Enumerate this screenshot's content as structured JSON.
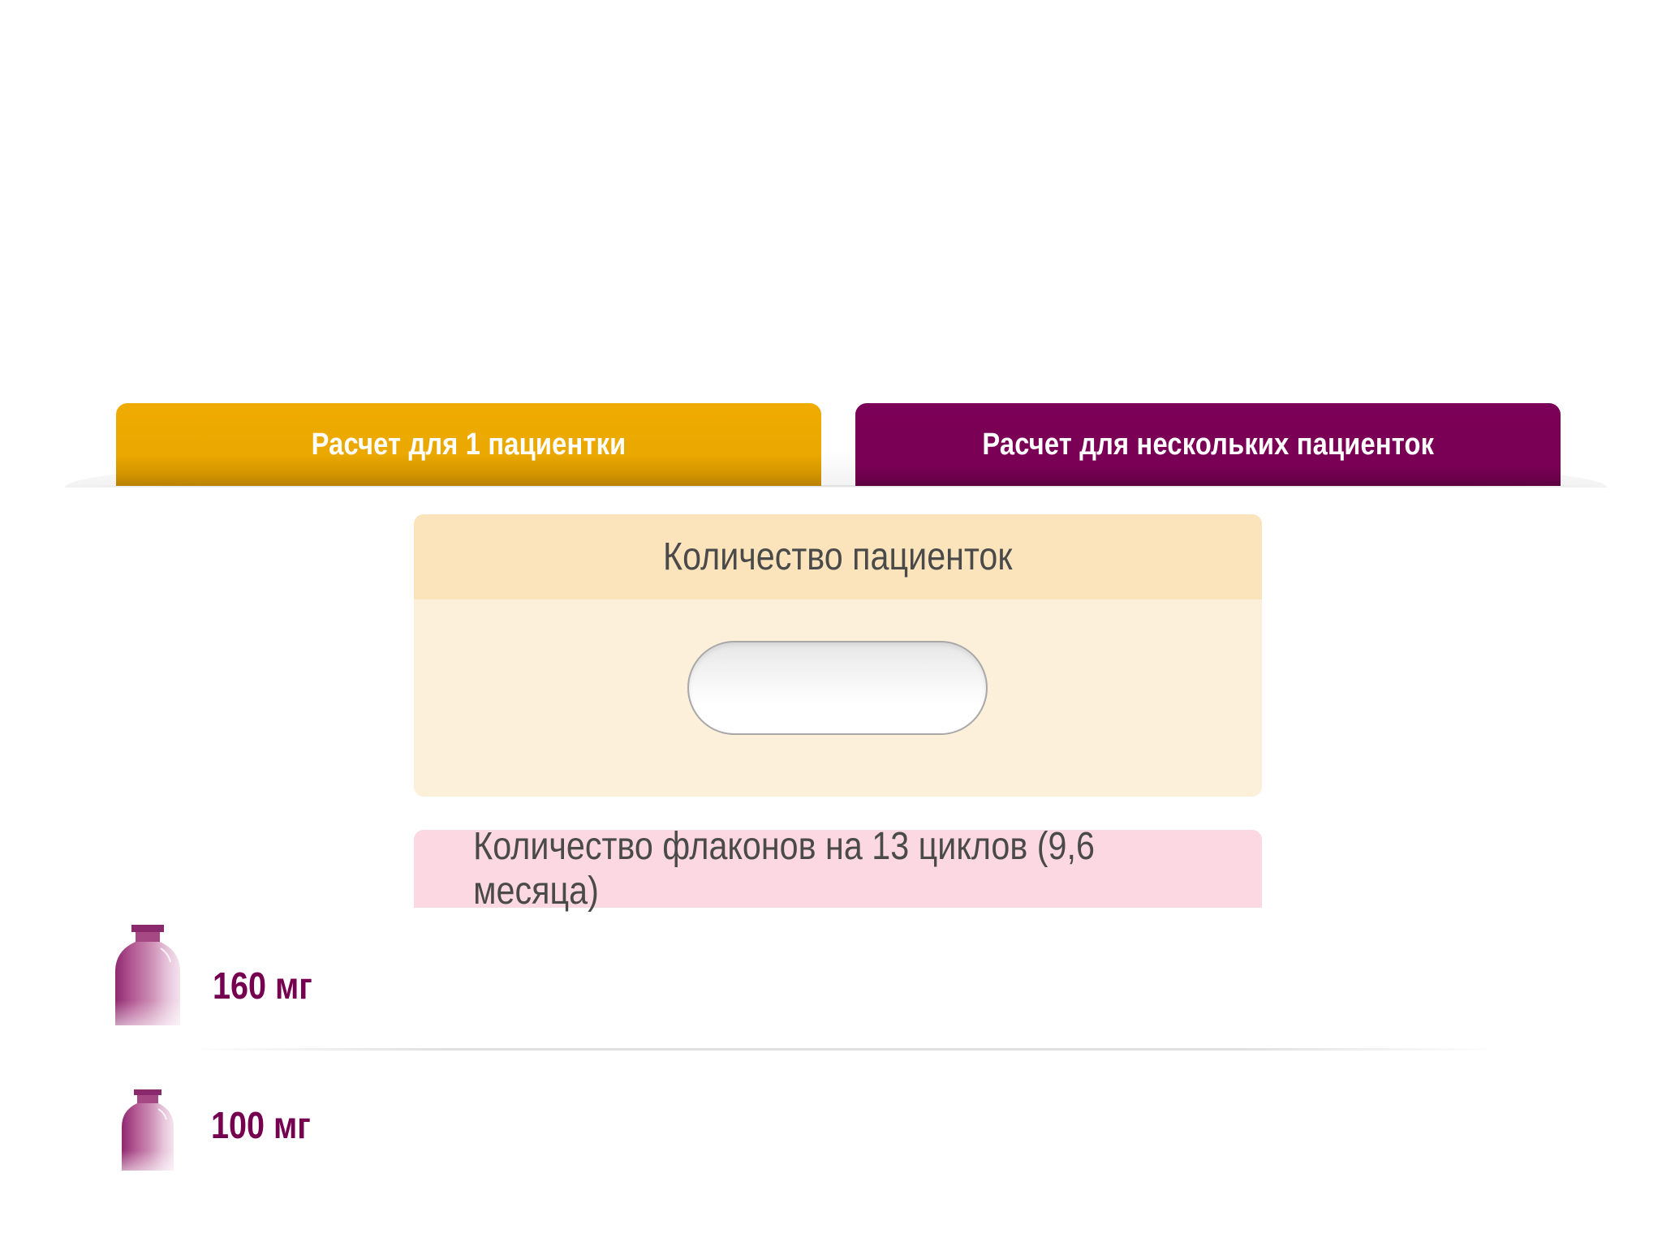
{
  "tabs": [
    {
      "label": "Расчет для 1 пациентки",
      "color": "#EDA900"
    },
    {
      "label": "Расчет для нескольких пациенток",
      "color": "#7A0056"
    }
  ],
  "patients_panel": {
    "title": "Количество пациенток",
    "input_value": ""
  },
  "result": {
    "title": "Количество флаконов на 13 циклов (9,6 месяца)",
    "rows": [
      {
        "icon": "vial-icon",
        "label": "160 мг"
      },
      {
        "icon": "vial-icon",
        "label": "100 мг"
      }
    ]
  },
  "colors": {
    "accent_purple": "#74004F",
    "accent_gold": "#EDA900",
    "panel_bg": "#FDF0DB",
    "panel_header_bg": "#FBE4BB",
    "result_header_bg": "#FBD8E2"
  }
}
